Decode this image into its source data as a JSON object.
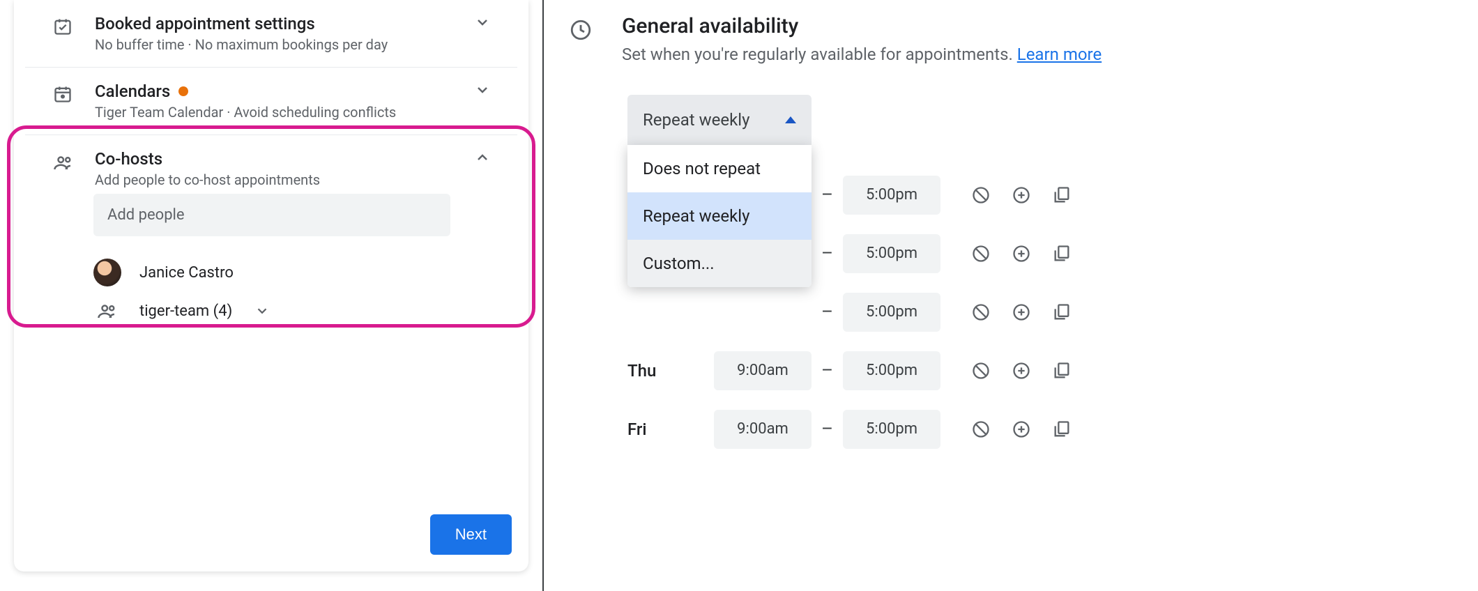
{
  "left": {
    "booked": {
      "title": "Booked appointment settings",
      "subtitle": "No buffer time · No maximum bookings per day"
    },
    "calendars": {
      "title": "Calendars",
      "subtitle": "Tiger Team Calendar · Avoid scheduling conflicts"
    },
    "cohosts": {
      "title": "Co-hosts",
      "subtitle": "Add people to co-host appointments",
      "add_placeholder": "Add people",
      "person_name": "Janice Castro",
      "group_label": "tiger-team (4)"
    },
    "next_label": "Next"
  },
  "right": {
    "title": "General availability",
    "subtitle_pre": "Set when you're regularly available for appointments. ",
    "learn_more": "Learn more",
    "repeat_selected": "Repeat weekly",
    "dropdown": {
      "opt0": "Does not repeat",
      "opt1": "Repeat weekly",
      "opt2": "Custom..."
    },
    "rows": [
      {
        "day": "",
        "start": "",
        "end": "5:00pm"
      },
      {
        "day": "",
        "start": "",
        "end": "5:00pm"
      },
      {
        "day": "",
        "start": "",
        "end": "5:00pm"
      },
      {
        "day": "Thu",
        "start": "9:00am",
        "end": "5:00pm"
      },
      {
        "day": "Fri",
        "start": "9:00am",
        "end": "5:00pm"
      }
    ]
  }
}
